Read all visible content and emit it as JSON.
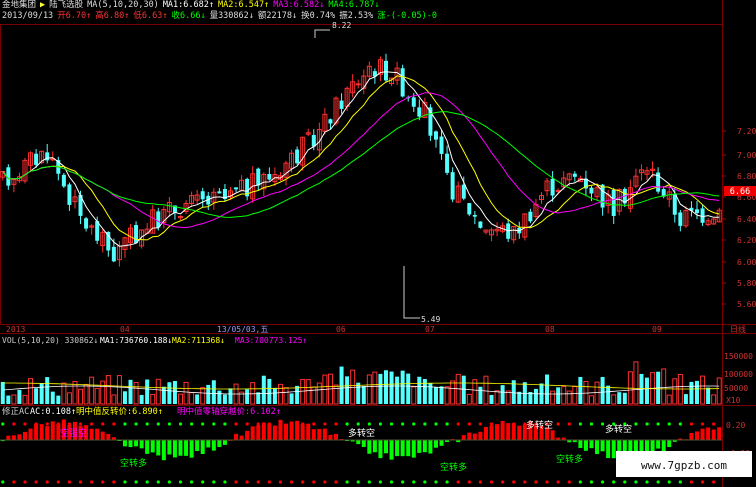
{
  "header": {
    "line1": {
      "stock": "金地集团",
      "arrow": "▶",
      "name": "陆飞选股",
      "ma_label": "MA(5,10,20,30)",
      "ma1": "MA1:6.682↑",
      "ma2": "MA2:6.547↑",
      "ma3": "MA3:6.582↓",
      "ma4": "MA4:6.787↓"
    },
    "line2": {
      "date": "2013/09/13",
      "open": "开6.70↑",
      "high": "高6.80↑",
      "low": "低6.63↑",
      "close": "收6.66↓",
      "vol": "量330862↓",
      "amount": "额22178↓",
      "turnover": "换0.74%",
      "amp": "振2.53%",
      "chg": "涨-(-0.05)-0"
    }
  },
  "price_axis": [
    "7.20",
    "7.00",
    "6.80",
    "6.60",
    "6.40",
    "6.20",
    "6.00",
    "5.80",
    "5.60"
  ],
  "current_price": "6.66",
  "annotations": {
    "high": "8.22",
    "low": "5.49"
  },
  "time_axis": [
    "2013",
    "04",
    "13/05/03,五",
    "06",
    "07",
    "08",
    "09"
  ],
  "period_label": "日线",
  "volume": {
    "label": "VOL(5,10,20)",
    "value": "330862↓",
    "ma1": "MA1:736760.188↓",
    "ma2": "MA2:711368↓",
    "ma3": "MA3:700773.125↑",
    "axis": [
      "150000",
      "100000",
      "50000"
    ],
    "unit": "X10"
  },
  "indicator": {
    "name": "修正AC",
    "ac": "AC:0.108↑",
    "mid": "明中值反转价:6.890↑",
    "axis_line": "明中值零轴穿越价:6.102↑",
    "axis": [
      "0.20",
      "-0.20"
    ],
    "labels": {
      "kong_duo": "空转多",
      "duo_kong": "多转空",
      "kong_qiang": "空强空"
    }
  },
  "watermark": "www.7gpzb.com",
  "colors": {
    "up": "#ff3030",
    "down": "#54ffff",
    "ma1": "#ffffff",
    "ma2": "#ffff00",
    "ma3": "#ff00ff",
    "ma4": "#00ff00",
    "green": "#00ff00",
    "red": "#ff0000"
  }
}
